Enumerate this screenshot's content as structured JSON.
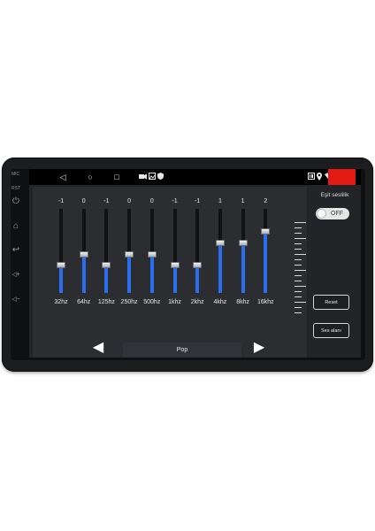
{
  "device": {
    "labels": {
      "mic": "MIC",
      "rst": "RST"
    },
    "buttons": [
      {
        "name": "power-icon",
        "glyph": "⏻"
      },
      {
        "name": "home-icon",
        "glyph": "⌂"
      },
      {
        "name": "back-icon",
        "glyph": "↩"
      },
      {
        "name": "volume-up-icon",
        "glyph": "◁+"
      },
      {
        "name": "volume-down-icon",
        "glyph": "◁−"
      }
    ]
  },
  "statusbar": {
    "nav": {
      "back": "◁",
      "home": "○",
      "recents": "□"
    },
    "icons": [
      "camera-icon",
      "gallery-icon",
      "shield-icon"
    ],
    "right_icons": [
      "cast-icon",
      "location-icon",
      "wifi-icon"
    ],
    "accent": "#e11b14"
  },
  "equalizer": {
    "bands": [
      {
        "label": "32hz",
        "value": "-1",
        "level": 0.34
      },
      {
        "label": "64hz",
        "value": "0",
        "level": 0.46
      },
      {
        "label": "125hz",
        "value": "-1",
        "level": 0.34
      },
      {
        "label": "250hz",
        "value": "0",
        "level": 0.46
      },
      {
        "label": "500hz",
        "value": "0",
        "level": 0.46
      },
      {
        "label": "1khz",
        "value": "-1",
        "level": 0.34
      },
      {
        "label": "2khz",
        "value": "-1",
        "level": 0.34
      },
      {
        "label": "4khz",
        "value": "1",
        "level": 0.6
      },
      {
        "label": "8khz",
        "value": "1",
        "level": 0.6
      },
      {
        "label": "16khz",
        "value": "2",
        "level": 0.74
      }
    ],
    "fill_color": "#2a6ff0",
    "preset": "Pop",
    "prev_arrow": "◀",
    "next_arrow": "▶"
  },
  "side": {
    "title": "Eşit seslilik",
    "toggle": "OFF",
    "reset": "Reset",
    "sound_field": "Ses alanı"
  }
}
